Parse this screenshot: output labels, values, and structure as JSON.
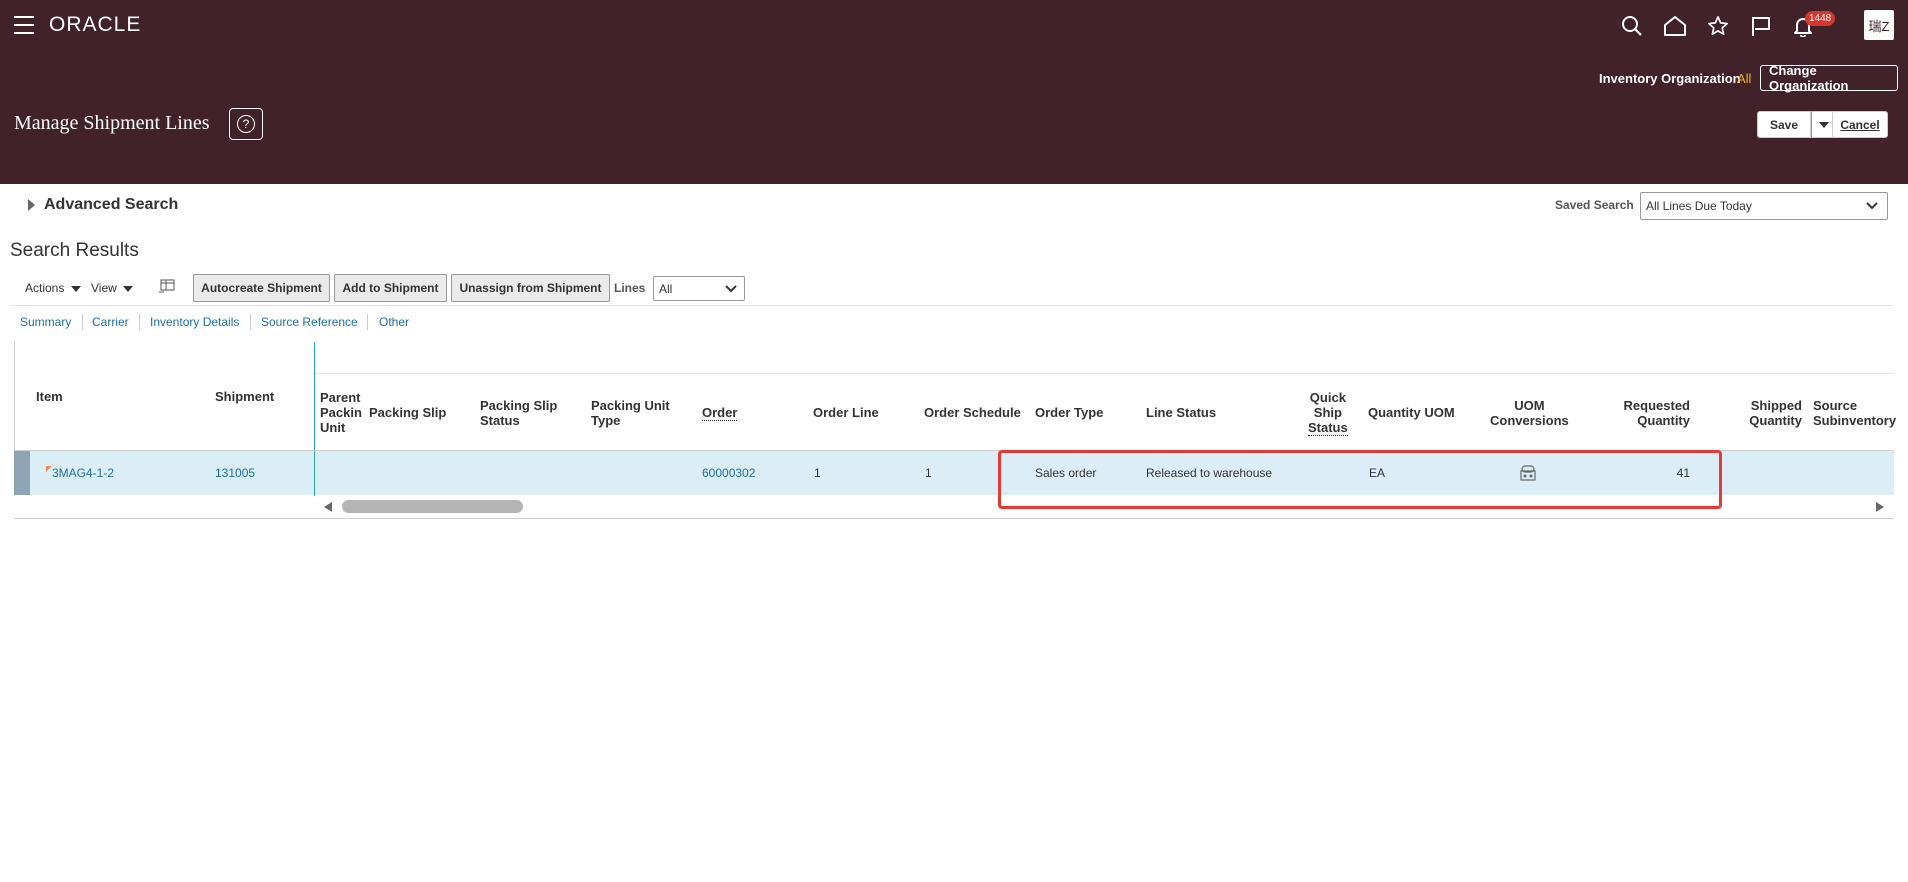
{
  "header": {
    "brand": "ORACLE",
    "notification_count": "1448",
    "avatar_text": "瑞Z",
    "inventory_org_label": "Inventory Organization",
    "inventory_org_value": "All",
    "change_org_label": "Change Organization",
    "page_title": "Manage Shipment Lines",
    "help_glyph": "?",
    "save_label": "Save",
    "cancel_label": "Cancel",
    "icons": [
      "menu-icon",
      "search-icon",
      "home-icon",
      "star-icon",
      "flag-icon",
      "bell-icon"
    ]
  },
  "search": {
    "advanced_label": "Advanced Search",
    "saved_search_label": "Saved Search",
    "saved_search_value": "All Lines Due Today",
    "results_title": "Search Results"
  },
  "toolbar": {
    "actions_label": "Actions",
    "view_label": "View",
    "autocreate_label": "Autocreate Shipment",
    "add_label": "Add to Shipment",
    "unassign_label": "Unassign from Shipment",
    "lines_label": "Lines",
    "lines_value": "All"
  },
  "tabs": [
    "Summary",
    "Carrier",
    "Inventory Details",
    "Source Reference",
    "Other"
  ],
  "columns": {
    "item": "Item",
    "shipment": "Shipment",
    "parent_packing_unit": [
      "Parent",
      "Packin",
      "Unit"
    ],
    "packing_slip": "Packing Slip",
    "packing_slip_status": [
      "Packing Slip",
      "Status"
    ],
    "packing_unit_type": [
      "Packing Unit",
      "Type"
    ],
    "order": "Order",
    "order_line": "Order Line",
    "order_schedule": "Order Schedule",
    "order_type": "Order Type",
    "line_status": "Line Status",
    "quick_ship_status": [
      "Quick",
      "Ship",
      "Status"
    ],
    "quantity_uom": "Quantity UOM",
    "uom_conversions": [
      "UOM",
      "Conversions"
    ],
    "requested_quantity": [
      "Requested",
      "Quantity"
    ],
    "shipped_quantity": [
      "Shipped",
      "Quantity"
    ],
    "source_subinventory": [
      "Source",
      "Subinventory"
    ]
  },
  "row": {
    "item": "3MAG4-1-2",
    "shipment": "131005",
    "order": "60000302",
    "order_line": "1",
    "order_schedule": "1",
    "order_type": "Sales order",
    "line_status": "Released to warehouse",
    "quantity_uom": "EA",
    "requested_quantity": "41"
  },
  "colors": {
    "header_bg": "#41222b",
    "link": "#1d6f9e",
    "row_selected": "#dbeef7",
    "highlight_box": "#e53935",
    "badge": "#d9362b",
    "org_value": "#f2b22e"
  }
}
